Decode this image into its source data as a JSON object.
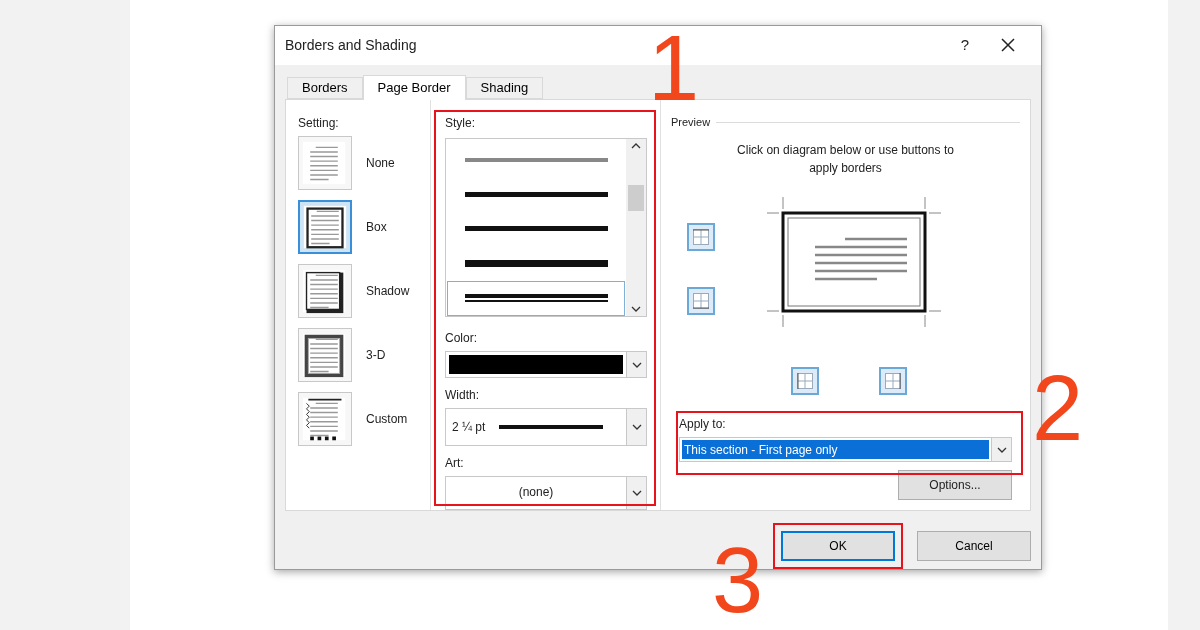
{
  "dialog": {
    "title": "Borders and Shading",
    "help": "?"
  },
  "tabs": [
    {
      "label": "Borders",
      "selected": false
    },
    {
      "label": "Page Border",
      "selected": true
    },
    {
      "label": "Shading",
      "selected": false
    }
  ],
  "setting": {
    "label": "Setting:",
    "options": [
      {
        "label": "None",
        "kind": "none",
        "selected": false
      },
      {
        "label": "Box",
        "kind": "box",
        "selected": true
      },
      {
        "label": "Shadow",
        "kind": "shadow",
        "selected": false
      },
      {
        "label": "3-D",
        "kind": "threed",
        "selected": false
      },
      {
        "label": "Custom",
        "kind": "custom",
        "selected": false
      }
    ]
  },
  "style": {
    "label": "Style:",
    "lines": [
      {
        "kind": "gray",
        "selected": false
      },
      {
        "kind": "solid",
        "selected": false
      },
      {
        "kind": "solid",
        "selected": false
      },
      {
        "kind": "thick",
        "selected": false
      },
      {
        "kind": "double",
        "selected": true
      }
    ]
  },
  "color": {
    "label": "Color:",
    "color": "#000000"
  },
  "width": {
    "label": "Width:",
    "value": "2 ¼ pt"
  },
  "art": {
    "label": "Art:",
    "value": "(none)"
  },
  "preview": {
    "label": "Preview",
    "hint": "Click on diagram below or use buttons to apply borders"
  },
  "apply_to": {
    "label": "Apply to:",
    "value": "This section - First page only"
  },
  "buttons": [
    {
      "label": "Options...",
      "kind": "options"
    },
    {
      "label": "OK",
      "kind": "default"
    },
    {
      "label": "Cancel",
      "kind": "normal"
    }
  ],
  "annotations": [
    {
      "label": "1"
    },
    {
      "label": "2"
    },
    {
      "label": "3"
    }
  ]
}
